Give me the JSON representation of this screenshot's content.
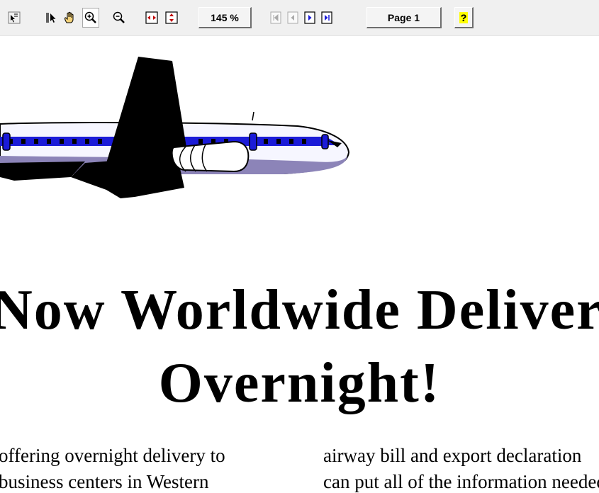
{
  "toolbar": {
    "icons": [
      {
        "name": "select-text-icon"
      },
      {
        "name": "pointer-icon"
      },
      {
        "name": "hand-pan-icon"
      },
      {
        "name": "zoom-in-icon"
      },
      {
        "name": "zoom-out-icon"
      },
      {
        "name": "fit-width-icon"
      },
      {
        "name": "fit-height-icon"
      },
      {
        "name": "first-page-icon"
      },
      {
        "name": "previous-page-icon"
      },
      {
        "name": "next-page-icon"
      },
      {
        "name": "last-page-icon"
      },
      {
        "name": "help-icon"
      }
    ],
    "zoom_label": "145 %",
    "page_label": "Page 1",
    "help_label": "?"
  },
  "document": {
    "headline_line1": "Now Worldwide Delivery",
    "headline_line2": "Overnight!",
    "col1_line1": "offering overnight delivery to",
    "col1_line2": "business centers in Western",
    "col2_line1": "airway bill and export declaration",
    "col2_line2": "can put all of the information needed"
  },
  "colors": {
    "toolbar_bg": "#f0f0f0",
    "plane_stripe": "#1b1bd8",
    "plane_body": "#f5f5ff"
  }
}
